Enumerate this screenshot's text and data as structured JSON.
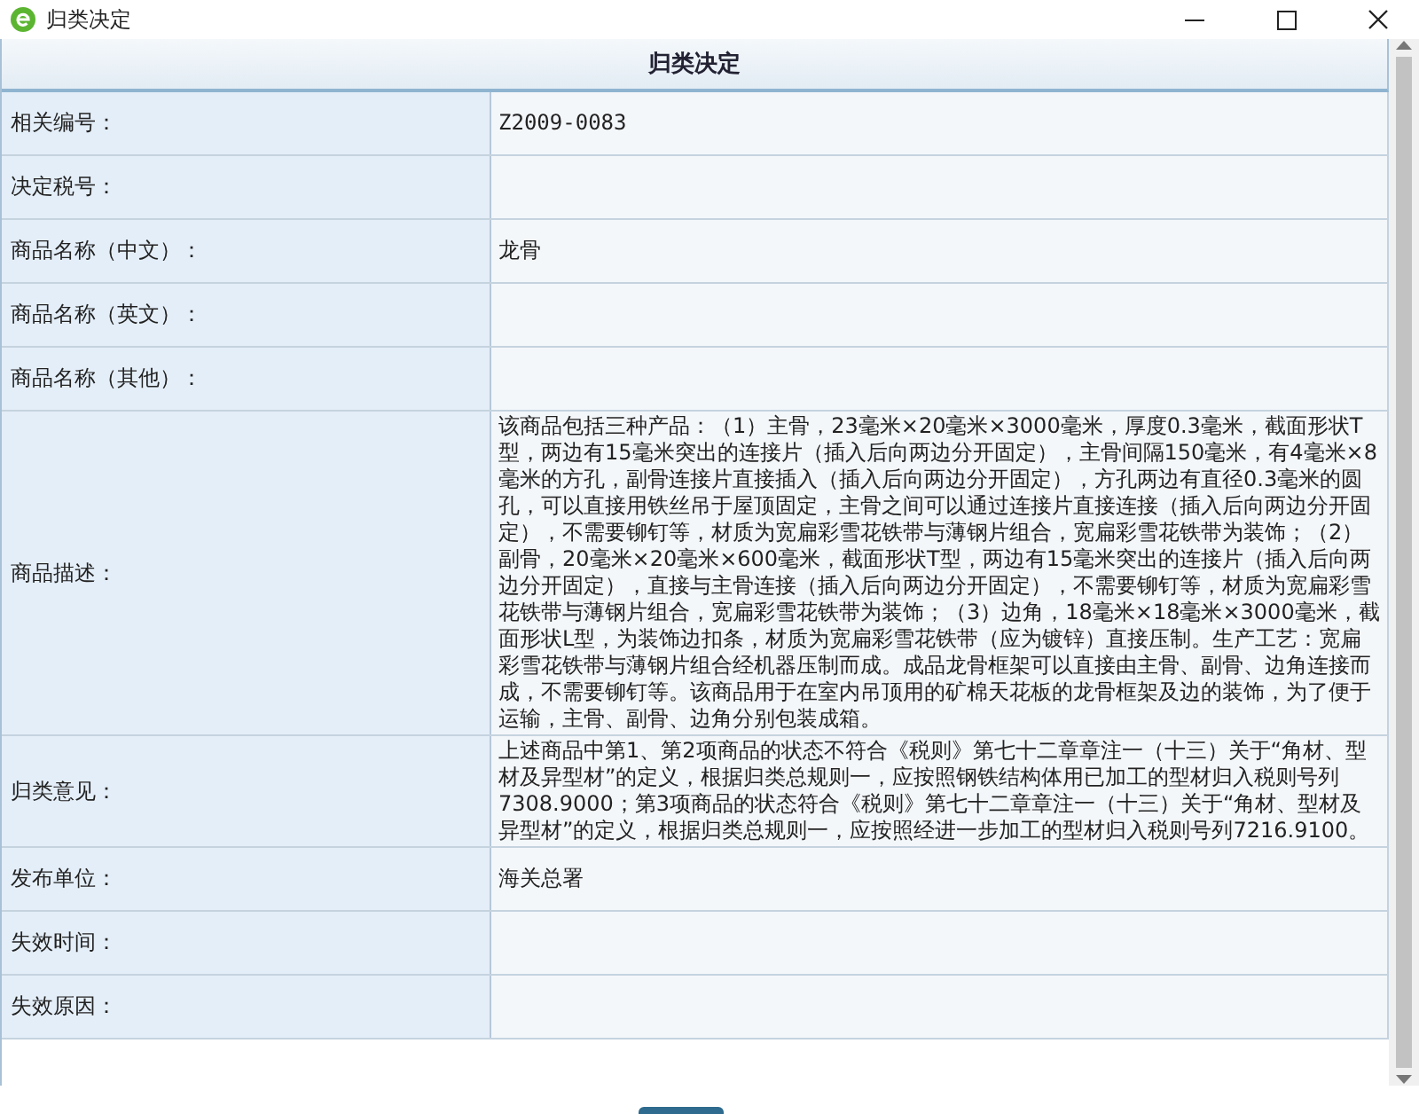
{
  "window": {
    "title": "归类决定"
  },
  "form": {
    "heading": "归类决定",
    "rows": [
      {
        "label": "相关编号：",
        "value": "Z2009-0083",
        "kind": "code"
      },
      {
        "label": "决定税号：",
        "kind": "text"
      },
      {
        "label": "商品名称（中文）：",
        "value": "龙骨",
        "kind": "text"
      },
      {
        "label": "商品名称（英文）：",
        "kind": "text"
      },
      {
        "label": "商品名称（其他）：",
        "kind": "text"
      },
      {
        "label": "商品描述：",
        "value": "该商品包括三种产品：（1）主骨，23毫米×20毫米×3000毫米，厚度0.3毫米，截面形状T型，两边有15毫米突出的连接片（插入后向两边分开固定），主骨间隔150毫米，有4毫米×8毫米的方孔，副骨连接片直接插入（插入后向两边分开固定），方孔两边有直径0.3毫米的圆孔，可以直接用铁丝吊于屋顶固定，主骨之间可以通过连接片直接连接（插入后向两边分开固定），不需要铆钉等，材质为宽扁彩雪花铁带与薄钢片组合，宽扁彩雪花铁带为装饰；（2）副骨，20毫米×20毫米×600毫米，截面形状T型，两边有15毫米突出的连接片（插入后向两边分开固定），直接与主骨连接（插入后向两边分开固定），不需要铆钉等，材质为宽扁彩雪花铁带与薄钢片组合，宽扁彩雪花铁带为装饰；（3）边角，18毫米×18毫米×3000毫米，截面形状L型，为装饰边扣条，材质为宽扁彩雪花铁带（应为镀锌）直接压制。生产工艺：宽扁彩雪花铁带与薄钢片组合经机器压制而成。成品龙骨框架可以直接由主骨、副骨、边角连接而成，不需要铆钉等。该商品用于在室内吊顶用的矿棉天花板的龙骨框架及边的装饰，为了便于运输，主骨、副骨、边角分别包装成箱。",
        "kind": "text"
      },
      {
        "label": "归类意见：",
        "value": "上述商品中第1、第2项商品的状态不符合《税则》第七十二章章注一（十三）关于“角材、型材及异型材”的定义，根据归类总规则一，应按照钢铁结构体用已加工的型材归入税则号列7308.9000；第3项商品的状态符合《税则》第七十二章章注一（十三）关于“角材、型材及异型材”的定义，根据归类总规则一，应按照经进一步加工的型材归入税则号列7216.9100。",
        "kind": "text"
      },
      {
        "label": "发布单位：",
        "value": "海关总署",
        "kind": "text"
      },
      {
        "label": "失效时间：",
        "kind": "text"
      },
      {
        "label": "失效原因：",
        "kind": "text"
      }
    ]
  }
}
